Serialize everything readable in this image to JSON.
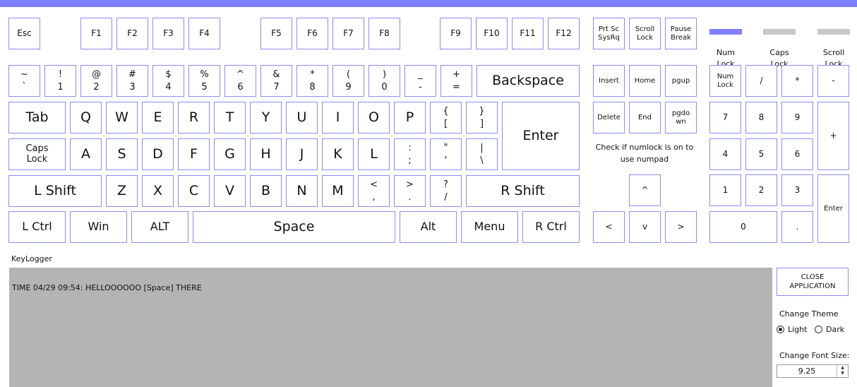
{
  "colors": {
    "accent": "#8080ff",
    "key_border": "#8c8cf0",
    "log_background": "#b4b4b4",
    "indicator_off": "#c8c8c8"
  },
  "function_row": {
    "esc": "Esc",
    "f1": "F1",
    "f2": "F2",
    "f3": "F3",
    "f4": "F4",
    "f5": "F5",
    "f6": "F6",
    "f7": "F7",
    "f8": "F8",
    "f9": "F9",
    "f10": "F10",
    "f11": "F11",
    "f12": "F12",
    "prtsc": "Prt Sc\nSysRq",
    "scroll_lock": "Scroll\nLock",
    "pause": "Pause\nBreak"
  },
  "indicators": [
    {
      "label": "Num\nLock",
      "active": true,
      "color": "#8080ff"
    },
    {
      "label": "Caps\nLock",
      "active": false,
      "color": "#c8c8c8"
    },
    {
      "label": "Scroll\nLock",
      "active": false,
      "color": "#c8c8c8"
    }
  ],
  "number_row": [
    [
      "~",
      "`"
    ],
    [
      "!",
      "1"
    ],
    [
      "@",
      "2"
    ],
    [
      "#",
      "3"
    ],
    [
      "$",
      "4"
    ],
    [
      "%",
      "5"
    ],
    [
      "^",
      "6"
    ],
    [
      "&",
      "7"
    ],
    [
      "*",
      "8"
    ],
    [
      "(",
      "9"
    ],
    [
      ")",
      "0"
    ],
    [
      "_",
      "-"
    ],
    [
      "+",
      "="
    ]
  ],
  "backspace": "Backspace",
  "tab": "Tab",
  "qwerty": [
    "Q",
    "W",
    "E",
    "R",
    "T",
    "Y",
    "U",
    "I",
    "O",
    "P"
  ],
  "brackets": [
    [
      "{",
      "["
    ],
    [
      "}",
      "]"
    ]
  ],
  "enter": "Enter",
  "caps_lock": "Caps\nLock",
  "home_row": [
    "A",
    "S",
    "D",
    "F",
    "G",
    "H",
    "J",
    "K",
    "L"
  ],
  "home_punct": [
    [
      ":",
      ";"
    ],
    [
      "\"",
      "'"
    ],
    [
      "|",
      "\\"
    ]
  ],
  "lshift": "L Shift",
  "bottom_letters": [
    "Z",
    "X",
    "C",
    "V",
    "B",
    "N",
    "M"
  ],
  "bottom_punct": [
    [
      "<",
      ","
    ],
    [
      ">",
      "."
    ],
    [
      "?",
      "/"
    ]
  ],
  "rshift": "R Shift",
  "lctrl": "L Ctrl",
  "win": "Win",
  "alt_left": "ALT",
  "space": "Space",
  "alt_right": "Alt",
  "menu": "Menu",
  "rctrl": "R Ctrl",
  "nav": {
    "insert": "Insert",
    "home": "Home",
    "pgup": "pgup",
    "delete": "Delete",
    "end": "End",
    "pgdown": "pgdo\nwn"
  },
  "numlock_note": "Check if numlock is on to use numpad",
  "arrows": {
    "up": "^",
    "left": "<",
    "down": "v",
    "right": ">"
  },
  "numpad": {
    "numlock": "Num\nLock",
    "divide": "/",
    "multiply": "*",
    "minus": "-",
    "n7": "7",
    "n8": "8",
    "n9": "9",
    "plus": "+",
    "n4": "4",
    "n5": "5",
    "n6": "6",
    "n1": "1",
    "n2": "2",
    "n3": "3",
    "enter": "Enter",
    "n0": "0",
    "dot": "."
  },
  "keylogger": {
    "label": "KeyLogger",
    "log_text": "TIME 04/29 09:54: HELLOOOOOO [Space] THERE"
  },
  "controls": {
    "close_button": "CLOSE\nAPPLICATION",
    "theme_label": "Change Theme",
    "theme_options": [
      "Light",
      "Dark"
    ],
    "theme_selected": "Light",
    "font_label": "Change Font Size:",
    "font_size": "9.25"
  }
}
